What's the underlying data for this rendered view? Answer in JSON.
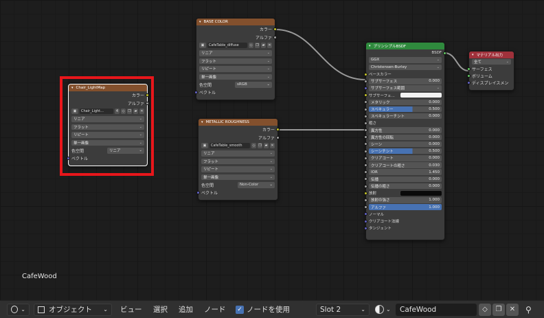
{
  "node_editor": {
    "material_name_label": "CafeWood",
    "nodes": {
      "lightmap": {
        "title": "Chair_LightMap",
        "outputs": [
          "カラー",
          "アルファ"
        ],
        "image_name": "Chair_Light...",
        "users": "4",
        "interpolation": "リニア",
        "projection": "フラット",
        "extension": "リピート",
        "source": "単一画像",
        "colorspace_label": "色空間",
        "colorspace_value": "リニア",
        "vector_label": "ベクトル"
      },
      "base_color": {
        "title": "BASE COLOR",
        "outputs": [
          "カラー",
          "アルファ"
        ],
        "image_name": "CafeTable_diffuse",
        "interpolation": "リニア",
        "projection": "フラット",
        "extension": "リピート",
        "source": "単一画像",
        "colorspace_label": "色空間",
        "colorspace_value": "sRGB",
        "vector_label": "ベクトル"
      },
      "metallic_roughness": {
        "title": "METALLIC ROUGHNESS",
        "outputs": [
          "カラー",
          "アルファ"
        ],
        "image_name": "CafeTable_smooth",
        "interpolation": "リニア",
        "projection": "フラット",
        "extension": "リピート",
        "source": "単一画像",
        "colorspace_label": "色空間",
        "colorspace_value": "Non-Color",
        "vector_label": "ベクトル"
      },
      "principled": {
        "title": "プリンシプルBSDF",
        "output": "BSDF",
        "distribution": "GGX",
        "subsurface_method": "Christensen-Burley",
        "inputs": [
          {
            "label": "ベースカラー"
          },
          {
            "label": "サブサーフェス",
            "value": "0.000"
          },
          {
            "label": "サブサーフェス範囲"
          },
          {
            "label": "サブサーフェ..."
          },
          {
            "label": "メタリック",
            "value": "0.000"
          },
          {
            "label": "スペキュラー",
            "value": "0.500"
          },
          {
            "label": "スペキュラーチント",
            "value": "0.000"
          },
          {
            "label": "粗さ"
          },
          {
            "label": "異方性",
            "value": "0.000"
          },
          {
            "label": "異方性の回転",
            "value": "0.000"
          },
          {
            "label": "シーン",
            "value": "0.000"
          },
          {
            "label": "シーンチント",
            "value": "0.500"
          },
          {
            "label": "クリアコート",
            "value": "0.000"
          },
          {
            "label": "クリアコートの粗さ",
            "value": "0.030"
          },
          {
            "label": "IOR",
            "value": "1.450"
          },
          {
            "label": "伝播",
            "value": "0.000"
          },
          {
            "label": "伝播の粗さ",
            "value": "0.000"
          },
          {
            "label": "放射"
          },
          {
            "label": "放射の強さ",
            "value": "1.000"
          },
          {
            "label": "アルファ",
            "value": "1.000"
          },
          {
            "label": "ノーマル"
          },
          {
            "label": "クリアコート法線"
          },
          {
            "label": "タンジェント"
          }
        ]
      },
      "output": {
        "title": "マテリアル出力",
        "target": "全て",
        "inputs": [
          "サーフェス",
          "ボリューム",
          "ディスプレイスメン"
        ]
      }
    }
  },
  "header": {
    "mode": "オブジェクト",
    "menus": [
      "ビュー",
      "選択",
      "追加",
      "ノード"
    ],
    "use_nodes_label": "ノードを使用",
    "slot": "Slot 2",
    "material": "CafeWood"
  },
  "colors": {
    "texture_header": "#83502d",
    "shader_header": "#2f8a3d",
    "output_header": "#a0313b",
    "selection_highlight": "#e8161b",
    "accent_blue": "#4772b3"
  }
}
